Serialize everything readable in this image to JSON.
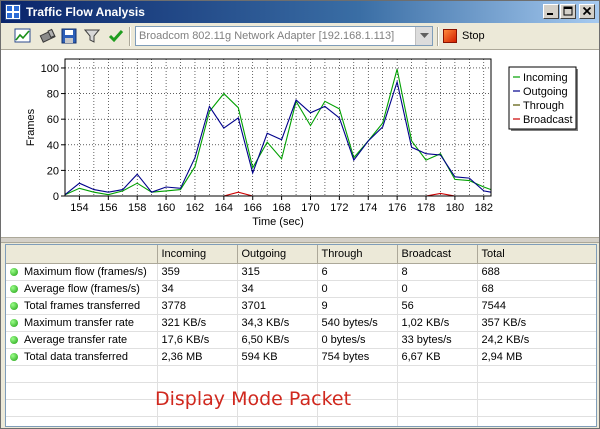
{
  "window": {
    "title": "Traffic Flow Analysis",
    "minimize_label": "minimize",
    "maximize_label": "maximize",
    "close_label": "close"
  },
  "toolbar": {
    "adapter": "Broadcom 802.11g Network Adapter [192.168.1.113]",
    "stop_label": "Stop",
    "icons": [
      "chart-icon",
      "pipe-icon",
      "save-icon",
      "filter-icon",
      "checkmark-icon"
    ]
  },
  "chart_data": {
    "type": "line",
    "xlabel": "Time (sec)",
    "ylabel": "Frames",
    "xlim": [
      153,
      182.5
    ],
    "ylim": [
      0,
      107
    ],
    "x_ticks": [
      154,
      156,
      158,
      160,
      162,
      164,
      166,
      168,
      170,
      172,
      174,
      176,
      178,
      180,
      182
    ],
    "y_ticks": [
      0,
      20,
      40,
      60,
      80,
      100
    ],
    "grid": true,
    "legend_position": "right",
    "x": [
      153,
      154,
      155,
      156,
      157,
      158,
      159,
      160,
      161,
      162,
      163,
      164,
      165,
      166,
      167,
      168,
      169,
      170,
      171,
      172,
      173,
      174,
      175,
      176,
      177,
      178,
      179,
      180,
      181,
      182,
      182.5
    ],
    "series": [
      {
        "name": "Incoming",
        "color": "#00a000",
        "values": [
          1,
          6,
          3,
          1,
          4,
          10,
          3,
          4,
          5,
          23,
          66,
          80,
          69,
          22,
          42,
          29,
          74,
          55,
          74,
          68,
          30,
          43,
          57,
          99,
          43,
          28,
          33,
          13,
          12,
          7,
          5
        ]
      },
      {
        "name": "Outgoing",
        "color": "#00008b",
        "values": [
          1,
          10,
          5,
          3,
          5,
          17,
          3,
          7,
          6,
          30,
          70,
          53,
          61,
          18,
          49,
          44,
          75,
          65,
          70,
          61,
          28,
          43,
          54,
          89,
          38,
          33,
          32,
          15,
          14,
          4,
          3
        ]
      },
      {
        "name": "Through",
        "color": "#555500",
        "values": [
          0,
          0,
          0,
          0,
          0,
          0,
          0,
          0,
          0,
          0,
          0,
          0,
          0,
          0,
          0,
          0,
          0,
          0,
          0,
          0,
          0,
          0,
          0,
          0,
          0,
          0,
          0,
          0,
          0,
          0,
          0
        ]
      },
      {
        "name": "Broadcast",
        "color": "#cc0000",
        "values": [
          0,
          0,
          0,
          0,
          0,
          0,
          0,
          0,
          0,
          0,
          0,
          0,
          3,
          0,
          0,
          0,
          0,
          0,
          0,
          0,
          0,
          0,
          0,
          0,
          0,
          0,
          2,
          0,
          0,
          0,
          0
        ]
      }
    ]
  },
  "table": {
    "columns": [
      "",
      "Incoming",
      "Outgoing",
      "Through",
      "Broadcast",
      "Total"
    ],
    "rows": [
      {
        "label": "Maximum flow (frames/s)",
        "values": [
          "359",
          "315",
          "6",
          "8",
          "688"
        ]
      },
      {
        "label": "Average flow (frames/s)",
        "values": [
          "34",
          "34",
          "0",
          "0",
          "68"
        ]
      },
      {
        "label": "Total frames transferred",
        "values": [
          "3778",
          "3701",
          "9",
          "56",
          "7544"
        ]
      },
      {
        "label": "Maximum transfer rate",
        "values": [
          "321 KB/s",
          "34,3 KB/s",
          "540 bytes/s",
          "1,02 KB/s",
          "357 KB/s"
        ]
      },
      {
        "label": "Average transfer rate",
        "values": [
          "17,6 KB/s",
          "6,50 KB/s",
          "0 bytes/s",
          "33 bytes/s",
          "24,2 KB/s"
        ]
      },
      {
        "label": "Total data transferred",
        "values": [
          "2,36 MB",
          "594 KB",
          "754 bytes",
          "6,67 KB",
          "2,94 MB"
        ]
      }
    ],
    "empty_rows": 4
  },
  "overlay_caption": "Display Mode Packet",
  "colors": {
    "title_bar_start": "#0a246a",
    "title_bar_end": "#a6caf0",
    "caption": "#d0281e",
    "status_dot": "#1d9d10"
  }
}
